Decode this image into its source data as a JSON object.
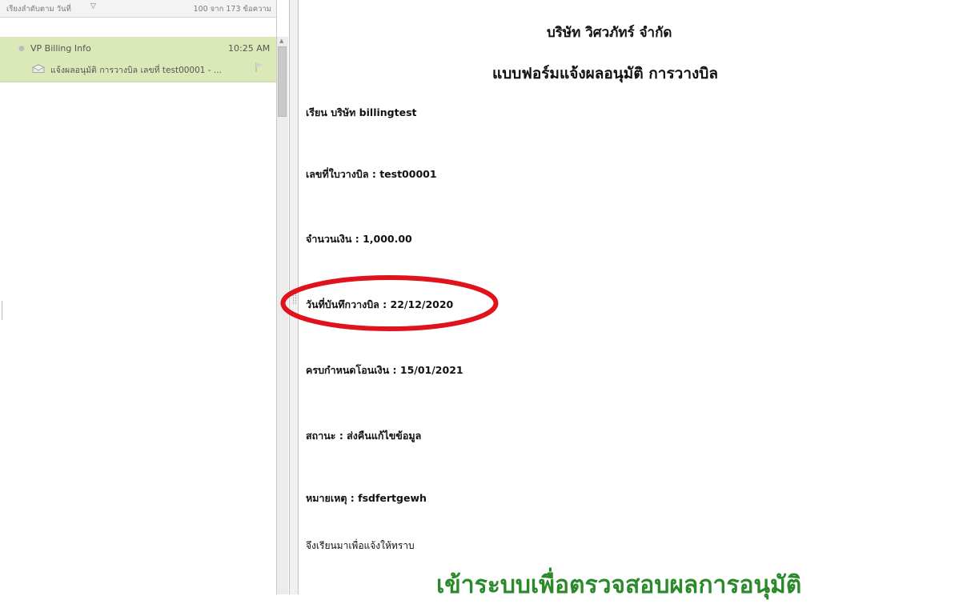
{
  "message_list": {
    "sort_label": "เรียงลำดับตาม วันที่",
    "sort_chevron": "▽",
    "count_label": "100 จาก 173 ข้อความ",
    "items": [
      {
        "sender": "VP Billing Info",
        "time": "10:25 AM",
        "subject": "แจ้งผลอนุมัติ การวางบิล เลขที่ test00001 - ...",
        "icon": "envelope-icon",
        "flag_icon": "flag-icon",
        "selected": true
      }
    ]
  },
  "scrollbar": {
    "up_arrow": "▲"
  },
  "email": {
    "company": "บริษัท วิศวภัทร์ จำกัด",
    "form_title": "แบบฟอร์มแจ้งผลอนุมัติ การวางบิล",
    "to_line": "เรียน บริษัท billingtest",
    "bill_number": "เลขที่ใบวางบิล : test00001",
    "amount": "จำนวนเงิน : 1,000.00",
    "record_date": "วันที่บันทึกวางบิล : 22/12/2020",
    "due_date": "ครบกำหนดโอนเงิน : 15/01/2021",
    "status": "สถานะ : ส่งคืนแก้ไขข้อมูล",
    "remark": "หมายเหตุ : fsdfertgewh",
    "closing": "จึงเรียนมาเพื่อแจ้งให้ทราบ",
    "login_link": "เข้าระบบเพื่อตรวจสอบผลการอนุมัติ"
  },
  "colors": {
    "selected_row": "#dbe9b8",
    "link_green": "#2a8a2a",
    "highlight_red": "#e0121b"
  }
}
